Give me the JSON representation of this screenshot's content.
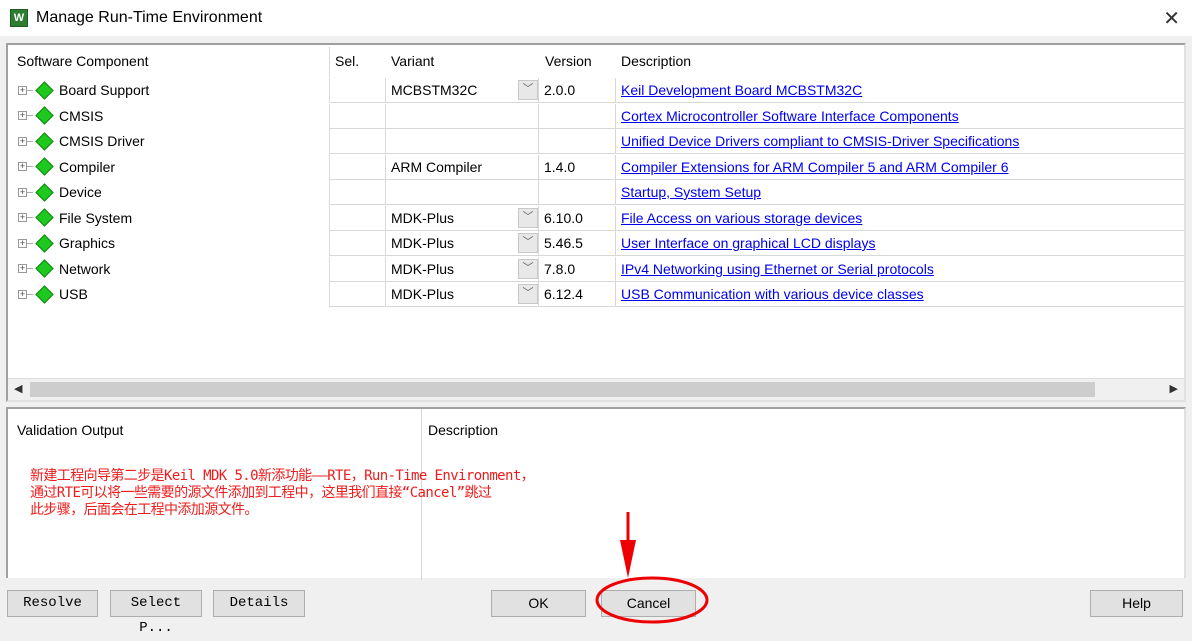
{
  "window": {
    "title": "Manage Run-Time Environment",
    "close_icon": "close-icon"
  },
  "table": {
    "headers": [
      "Software Component",
      "Sel.",
      "Variant",
      "Version",
      "Description"
    ],
    "rows": [
      {
        "component": "Board Support",
        "variant": "MCBSTM32C",
        "dropdown": true,
        "version": "2.0.0",
        "description": "Keil Development Board MCBSTM32C"
      },
      {
        "component": "CMSIS",
        "variant": "",
        "dropdown": false,
        "version": "",
        "description": "Cortex Microcontroller Software Interface Components"
      },
      {
        "component": "CMSIS Driver",
        "variant": "",
        "dropdown": false,
        "version": "",
        "description": "Unified Device Drivers compliant to CMSIS-Driver Specifications"
      },
      {
        "component": "Compiler",
        "variant": "ARM Compiler",
        "dropdown": false,
        "version": "1.4.0",
        "description": "Compiler Extensions for ARM Compiler 5 and ARM Compiler 6"
      },
      {
        "component": "Device",
        "variant": "",
        "dropdown": false,
        "version": "",
        "description": "Startup, System Setup"
      },
      {
        "component": "File System",
        "variant": "MDK-Plus",
        "dropdown": true,
        "version": "6.10.0",
        "description": "File Access on various storage devices"
      },
      {
        "component": "Graphics",
        "variant": "MDK-Plus",
        "dropdown": true,
        "version": "5.46.5",
        "description": "User Interface on graphical LCD displays"
      },
      {
        "component": "Network",
        "variant": "MDK-Plus",
        "dropdown": true,
        "version": "7.8.0",
        "description": "IPv4 Networking using Ethernet or Serial protocols"
      },
      {
        "component": "USB",
        "variant": "MDK-Plus",
        "dropdown": true,
        "version": "6.12.4",
        "description": "USB Communication with various device classes"
      }
    ]
  },
  "validation": {
    "headers": [
      "Validation Output",
      "Description"
    ],
    "annotation": "新建工程向导第二步是Keil MDK 5.0新添功能——RTE，Run-Time Environment，\n通过RTE可以将一些需要的源文件添加到工程中，这里我们直接“Cancel”跳过\n此步骤，后面会在工程中添加源文件。"
  },
  "buttons": {
    "resolve": "Resolve",
    "select_packs": "Select P...",
    "details": "Details",
    "ok": "OK",
    "cancel": "Cancel",
    "help": "Help"
  }
}
